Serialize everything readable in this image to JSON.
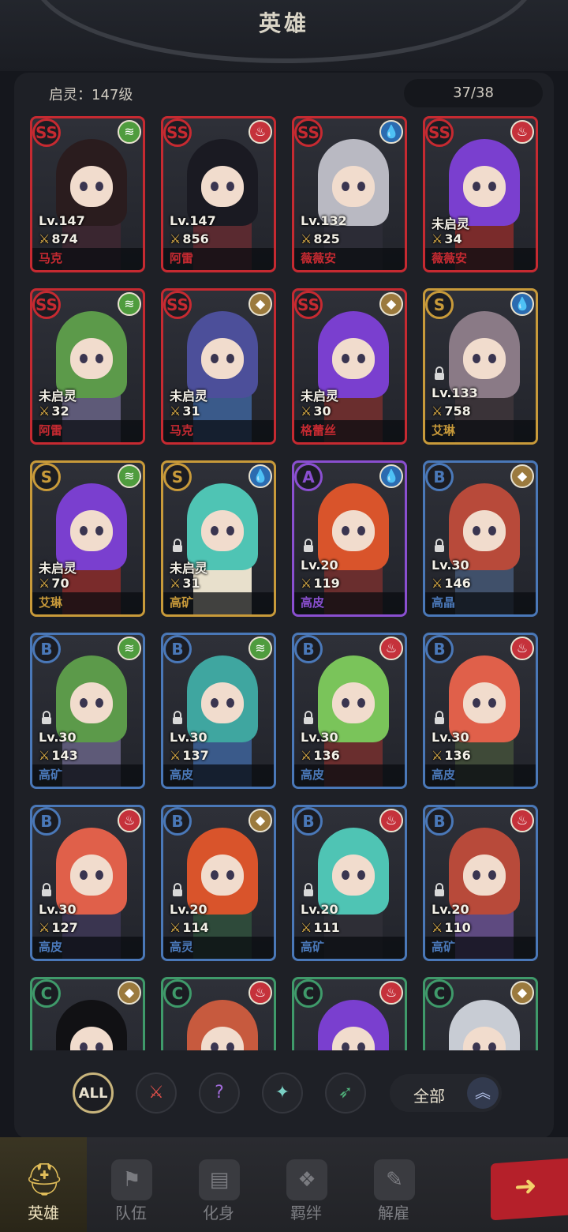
{
  "header": {
    "title": "英雄"
  },
  "summary": {
    "qiling_level": "启灵：147级",
    "hero_count": "37/38"
  },
  "colors": {
    "SS": "#c62a31",
    "S": "#c89a3a",
    "A": "#8a4fd0",
    "B": "#4a78b8",
    "C": "#3f9a6a",
    "fire": "#c5323b",
    "water": "#2b6bb0",
    "wind": "#4f9c3e",
    "earth": "#9b7a3e"
  },
  "heroes": [
    {
      "grade": "SS",
      "element": "wind",
      "level": "Lv.147",
      "power": "874",
      "name": "马克",
      "locked": false,
      "hair": "#2a1c1e",
      "outfit": "#3a2630"
    },
    {
      "grade": "SS",
      "element": "fire",
      "level": "Lv.147",
      "power": "856",
      "name": "阿雷",
      "locked": false,
      "hair": "#1a1a22",
      "outfit": "#5a2a30"
    },
    {
      "grade": "SS",
      "element": "water",
      "level": "Lv.132",
      "power": "825",
      "name": "薇薇安",
      "locked": false,
      "hair": "#b9b9c2",
      "outfit": "#2c2c36"
    },
    {
      "grade": "SS",
      "element": "fire",
      "level": "未启灵",
      "power": "34",
      "name": "薇薇安",
      "locked": false,
      "hair": "#7a3fcf",
      "outfit": "#7a2b2b"
    },
    {
      "grade": "SS",
      "element": "wind",
      "level": "未启灵",
      "power": "32",
      "name": "阿雷",
      "locked": false,
      "hair": "#5c9a4a",
      "outfit": "#5e5a78"
    },
    {
      "grade": "SS",
      "element": "earth",
      "level": "未启灵",
      "power": "31",
      "name": "马克",
      "locked": false,
      "hair": "#4c4f9a",
      "outfit": "#3a5a8a"
    },
    {
      "grade": "SS",
      "element": "earth",
      "level": "未启灵",
      "power": "30",
      "name": "格蕾丝",
      "locked": false,
      "hair": "#7a3fcf",
      "outfit": "#6a2e2e"
    },
    {
      "grade": "S",
      "element": "water",
      "level": "Lv.133",
      "power": "758",
      "name": "艾琳",
      "locked": true,
      "hair": "#8a7a86",
      "outfit": "#3a3338"
    },
    {
      "grade": "S",
      "element": "wind",
      "level": "未启灵",
      "power": "70",
      "name": "艾琳",
      "locked": false,
      "hair": "#7a3fcf",
      "outfit": "#7a2b2b"
    },
    {
      "grade": "S",
      "element": "water",
      "level": "未启灵",
      "power": "31",
      "name": "高矿",
      "locked": true,
      "hair": "#4fc4b4",
      "outfit": "#e8e0cc"
    },
    {
      "grade": "A",
      "element": "water",
      "level": "Lv.20",
      "power": "119",
      "name": "高皮",
      "locked": true,
      "hair": "#d9542b",
      "outfit": "#6a2e2e"
    },
    {
      "grade": "B",
      "element": "earth",
      "level": "Lv.30",
      "power": "146",
      "name": "高晶",
      "locked": true,
      "hair": "#b84a3a",
      "outfit": "#40506a"
    },
    {
      "grade": "B",
      "element": "wind",
      "level": "Lv.30",
      "power": "143",
      "name": "高矿",
      "locked": true,
      "hair": "#5c9a4a",
      "outfit": "#5e5a78"
    },
    {
      "grade": "B",
      "element": "wind",
      "level": "Lv.30",
      "power": "137",
      "name": "高皮",
      "locked": true,
      "hair": "#3fa6a0",
      "outfit": "#3a5a8a"
    },
    {
      "grade": "B",
      "element": "fire",
      "level": "Lv.30",
      "power": "136",
      "name": "高皮",
      "locked": true,
      "hair": "#7ac45a",
      "outfit": "#6a2e2e"
    },
    {
      "grade": "B",
      "element": "fire",
      "level": "Lv.30",
      "power": "136",
      "name": "高皮",
      "locked": true,
      "hair": "#e0604a",
      "outfit": "#3f4a38"
    },
    {
      "grade": "B",
      "element": "fire",
      "level": "Lv.30",
      "power": "127",
      "name": "高皮",
      "locked": true,
      "hair": "#e0604a",
      "outfit": "#3a3550"
    },
    {
      "grade": "B",
      "element": "earth",
      "level": "Lv.20",
      "power": "114",
      "name": "高灵",
      "locked": true,
      "hair": "#d9542b",
      "outfit": "#2e4a3a"
    },
    {
      "grade": "B",
      "element": "fire",
      "level": "Lv.20",
      "power": "111",
      "name": "高矿",
      "locked": true,
      "hair": "#4fc4b4",
      "outfit": "#2e2e36"
    },
    {
      "grade": "B",
      "element": "fire",
      "level": "Lv.20",
      "power": "110",
      "name": "高矿",
      "locked": true,
      "hair": "#b84a3a",
      "outfit": "#5e4a80"
    },
    {
      "grade": "C",
      "element": "earth",
      "level": "",
      "power": "",
      "name": "",
      "locked": false,
      "hair": "#111114",
      "outfit": "#2c2c34"
    },
    {
      "grade": "C",
      "element": "fire",
      "level": "",
      "power": "",
      "name": "",
      "locked": false,
      "hair": "#c75a3e",
      "outfit": "#2c2c34"
    },
    {
      "grade": "C",
      "element": "fire",
      "level": "",
      "power": "",
      "name": "",
      "locked": false,
      "hair": "#7a3fcf",
      "outfit": "#2c2c34"
    },
    {
      "grade": "C",
      "element": "earth",
      "level": "",
      "power": "",
      "name": "",
      "locked": false,
      "hair": "#c8ccd4",
      "outfit": "#2c2c34"
    }
  ],
  "filters": {
    "all_label": "ALL",
    "class_icons": [
      "warrior-class-icon",
      "mystic-class-icon",
      "support-class-icon",
      "ranger-class-icon"
    ],
    "sort_label": "全部"
  },
  "nav": {
    "items": [
      {
        "label": "英雄",
        "icon": "helmet-icon",
        "active": true
      },
      {
        "label": "队伍",
        "icon": "flag-icon",
        "active": false
      },
      {
        "label": "化身",
        "icon": "cards-icon",
        "active": false
      },
      {
        "label": "羁绊",
        "icon": "book-icon",
        "active": false
      },
      {
        "label": "解雇",
        "icon": "scroll-icon",
        "active": false
      }
    ]
  }
}
